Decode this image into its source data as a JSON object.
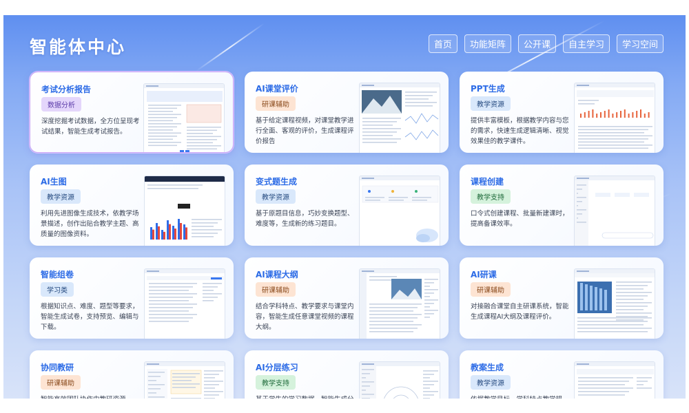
{
  "app": {
    "title": "智能体中心"
  },
  "nav": {
    "items": [
      {
        "label": "首页"
      },
      {
        "label": "功能矩阵"
      },
      {
        "label": "公开课"
      },
      {
        "label": "自主学习"
      },
      {
        "label": "学习空间"
      }
    ]
  },
  "cards": [
    {
      "title": "考试分析报告",
      "tag": "数据分析",
      "tag_color": "purple",
      "desc": "深度挖掘考试数据，全方位呈现考试结果，智能生成考试报告。",
      "active": true
    },
    {
      "title": "AI课堂评价",
      "tag": "研课辅助",
      "tag_color": "orange",
      "desc": "基于给定课程视频，对课堂教学进行全面、客观的评价，生成课程评价报告"
    },
    {
      "title": "PPT生成",
      "tag": "教学资源",
      "tag_color": "blue",
      "desc": "提供丰富模板，根据教学内容与您的需求，快速生成逻辑清晰、视觉效果佳的教学课件。"
    },
    {
      "title": "AI生图",
      "tag": "教学资源",
      "tag_color": "blue",
      "desc": "利用先进图像生成技术，依教学场景描述，创作出贴合教学主题、高质量的图像资料。"
    },
    {
      "title": "变式题生成",
      "tag": "教学资源",
      "tag_color": "blue",
      "desc": "基于原题目信息，巧妙变换题型、难度等，生成新的练习题目。"
    },
    {
      "title": "课程创建",
      "tag": "教学支持",
      "tag_color": "green",
      "desc": "口令式创建课程、批量新建课时，提高备课效率。"
    },
    {
      "title": "智能组卷",
      "tag": "学习类",
      "tag_color": "blue",
      "desc": "根据知识点、难度、题型等要求，智能生成试卷，支持预览、编辑与下载。"
    },
    {
      "title": "AI课程大纲",
      "tag": "研课辅助",
      "tag_color": "orange",
      "desc": "结合学科特点、教学要求与课堂内容，智能生成任意课堂视频的课程大纲。"
    },
    {
      "title": "AI研课",
      "tag": "研课辅助",
      "tag_color": "orange",
      "desc": "对接融合课堂自主研课系统，智能生成课程AI大纲及课程评价。"
    },
    {
      "title": "协同教研",
      "tag": "研课辅助",
      "tag_color": "orange",
      "desc": "智能高效团队协作中教研资源"
    },
    {
      "title": "AI分层练习",
      "tag": "教学支持",
      "tag_color": "green",
      "desc": "基于学生的学习数据，智能生成分"
    },
    {
      "title": "教案生成",
      "tag": "教学资源",
      "tag_color": "blue",
      "desc": "依据教学目标、学科特点教学规"
    }
  ],
  "colors": {
    "accent": "#2c6be6",
    "bg_top": "#5f8ff0",
    "bg_bottom": "#d8e3f9"
  }
}
